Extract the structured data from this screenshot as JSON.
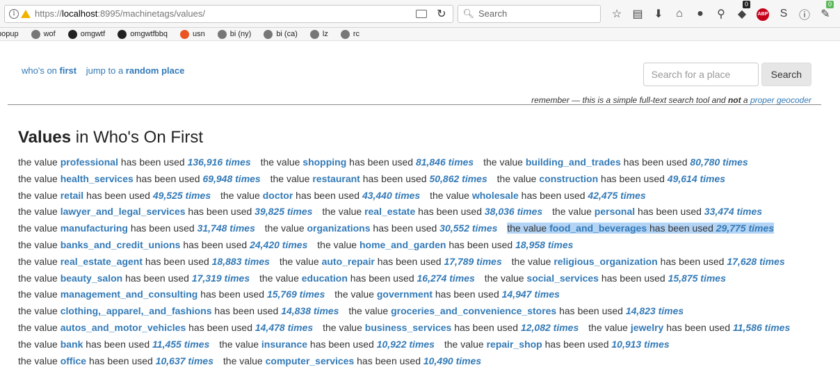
{
  "browser": {
    "url_scheme": "https://",
    "url_host": "localhost",
    "url_rest": ":8995/machinetags/values/",
    "search_placeholder": "Search",
    "badge_count": "0",
    "badge_green": "0",
    "abp_label": "ABP"
  },
  "bookmarks": [
    {
      "label": "popup",
      "icon": "globe-icon"
    },
    {
      "label": "wof",
      "icon": "globe-icon"
    },
    {
      "label": "omgwtf",
      "icon": "github-icon"
    },
    {
      "label": "omgwtfbbq",
      "icon": "github-icon"
    },
    {
      "label": "usn",
      "icon": "ubuntu-icon"
    },
    {
      "label": "bi (ny)",
      "icon": "globe-icon"
    },
    {
      "label": "bi (ca)",
      "icon": "globe-icon"
    },
    {
      "label": "lz",
      "icon": "globe-icon"
    },
    {
      "label": "rc",
      "icon": "globe-icon"
    }
  ],
  "header": {
    "whos_on_prefix": "who's on ",
    "whos_on_strong": "first",
    "jump_prefix": "jump to a ",
    "jump_strong": "random place",
    "search_placeholder": "Search for a place",
    "search_button": "Search",
    "remember_1": "remember — this is a simple full-text search tool and ",
    "remember_not": "not",
    "remember_2": " a ",
    "remember_link": "proper geocoder"
  },
  "page": {
    "title_strong": "Values",
    "title_rest": " in Who's On First",
    "prefix": "the value ",
    "middle": " has been used "
  },
  "values": [
    {
      "name": "professional",
      "count": "136,916 times"
    },
    {
      "name": "shopping",
      "count": "81,846 times"
    },
    {
      "name": "building_and_trades",
      "count": "80,780 times"
    },
    {
      "name": "health_services",
      "count": "69,948 times"
    },
    {
      "name": "restaurant",
      "count": "50,862 times"
    },
    {
      "name": "construction",
      "count": "49,614 times"
    },
    {
      "name": "retail",
      "count": "49,525 times"
    },
    {
      "name": "doctor",
      "count": "43,440 times"
    },
    {
      "name": "wholesale",
      "count": "42,475 times"
    },
    {
      "name": "lawyer_and_legal_services",
      "count": "39,825 times"
    },
    {
      "name": "real_estate",
      "count": "38,036 times"
    },
    {
      "name": "personal",
      "count": "33,474 times"
    },
    {
      "name": "manufacturing",
      "count": "31,748 times"
    },
    {
      "name": "organizations",
      "count": "30,552 times"
    },
    {
      "name": "food_and_beverages",
      "count": "29,775 times",
      "highlighted": true
    },
    {
      "name": "banks_and_credit_unions",
      "count": "24,420 times"
    },
    {
      "name": "home_and_garden",
      "count": "18,958 times"
    },
    {
      "name": "real_estate_agent",
      "count": "18,883 times"
    },
    {
      "name": "auto_repair",
      "count": "17,789 times"
    },
    {
      "name": "religious_organization",
      "count": "17,628 times"
    },
    {
      "name": "beauty_salon",
      "count": "17,319 times"
    },
    {
      "name": "education",
      "count": "16,274 times"
    },
    {
      "name": "social_services",
      "count": "15,875 times"
    },
    {
      "name": "management_and_consulting",
      "count": "15,769 times"
    },
    {
      "name": "government",
      "count": "14,947 times"
    },
    {
      "name": "clothing,_apparel,_and_fashions",
      "count": "14,838 times"
    },
    {
      "name": "groceries_and_convenience_stores",
      "count": "14,823 times"
    },
    {
      "name": "autos_and_motor_vehicles",
      "count": "14,478 times"
    },
    {
      "name": "business_services",
      "count": "12,082 times"
    },
    {
      "name": "jewelry",
      "count": "11,586 times"
    },
    {
      "name": "bank",
      "count": "11,455 times"
    },
    {
      "name": "insurance",
      "count": "10,922 times"
    },
    {
      "name": "repair_shop",
      "count": "10,913 times"
    },
    {
      "name": "office",
      "count": "10,637 times"
    },
    {
      "name": "computer_services",
      "count": "10,490 times"
    }
  ],
  "colors": {
    "link": "#337ab7",
    "highlight": "#b3d4f5"
  }
}
